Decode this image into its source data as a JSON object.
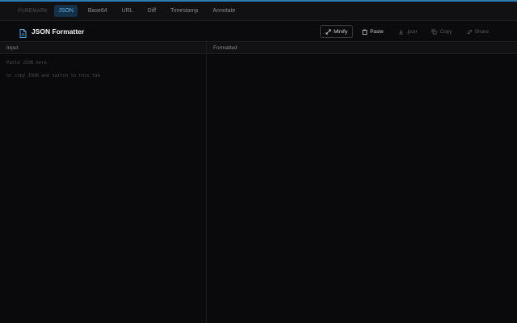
{
  "nav": {
    "brand": "PUREMARK",
    "tabs": [
      {
        "label": "JSON",
        "active": true
      },
      {
        "label": "Base64",
        "active": false
      },
      {
        "label": "URL",
        "active": false
      },
      {
        "label": "Diff",
        "active": false
      },
      {
        "label": "Timestamp",
        "active": false
      },
      {
        "label": "Annotate",
        "active": false
      }
    ]
  },
  "header": {
    "icon": "document-icon",
    "title": "JSON Formatter",
    "actions": [
      {
        "label": "Minify",
        "icon": "expand-arrows-icon"
      },
      {
        "label": "Paste",
        "icon": "clipboard-icon"
      },
      {
        "label": ".json",
        "icon": "download-icon"
      },
      {
        "label": "Copy",
        "icon": "copy-icon"
      },
      {
        "label": "Share",
        "icon": "link-icon"
      }
    ]
  },
  "input_pane": {
    "label": "Input",
    "placeholder_lines": [
      "Paste JSON here.",
      "or copy JSON and switch to this tab"
    ]
  },
  "output_pane": {
    "label": "Formatted"
  },
  "colors": {
    "accent": "#2b7fb8",
    "active_tab_bg": "#13324a",
    "active_tab_text": "#5fb3e8",
    "background": "#0b0b0d"
  }
}
